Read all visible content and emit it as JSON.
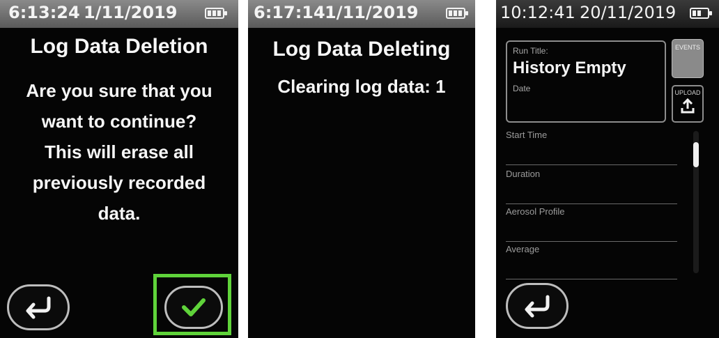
{
  "screens": [
    {
      "status": {
        "time": "6:13:24",
        "date": "1/11/2019"
      },
      "title": "Log Data Deletion",
      "message_lines": [
        "Are you sure that you",
        "want to continue?",
        "This will erase all",
        "previously recorded",
        "data."
      ],
      "back_icon": "return-arrow-icon",
      "confirm_icon": "checkmark-icon",
      "highlight_color": "#5fd33a"
    },
    {
      "status": {
        "time": "6:17:14",
        "date": "1/11/2019"
      },
      "title": "Log Data Deleting",
      "message_lines": [
        "Clearing log data: 1"
      ]
    },
    {
      "status": {
        "time": "10:12:41",
        "date": "20/11/2019"
      },
      "run_title_label": "Run Title:",
      "run_title_value": "History Empty",
      "date_label": "Date",
      "events_label": "EVENTS",
      "upload_label": "UPLOAD",
      "fields": [
        "Start Time",
        "Duration",
        "Aerosol Profile",
        "Average"
      ],
      "back_icon": "return-arrow-icon"
    }
  ]
}
